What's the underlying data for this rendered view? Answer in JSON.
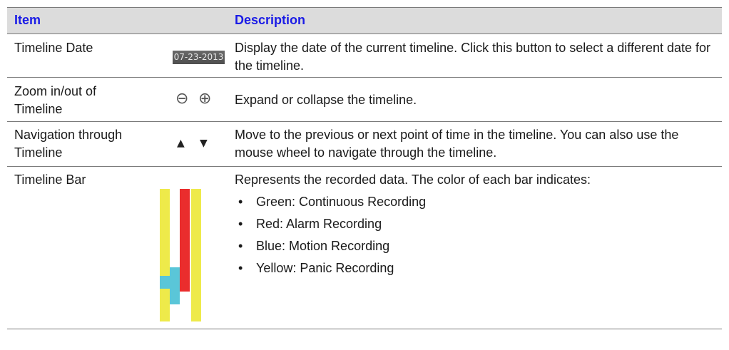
{
  "header": {
    "item": "Item",
    "description": "Description"
  },
  "rows": [
    {
      "item": "Timeline Date",
      "description": "Display the date of the current timeline. Click this button to select a different date for the timeline.",
      "icon": "date-button",
      "date_label": "07-23-2013"
    },
    {
      "item": "Zoom in/out of Timeline",
      "description": "Expand or collapse the timeline.",
      "icon": "zoom-icons",
      "zoom_out_glyph": "⊖",
      "zoom_in_glyph": "⊕"
    },
    {
      "item": "Navigation through Timeline",
      "description": "Move to the previous or next point of time in the timeline. You can also use the mouse wheel to navigate through the timeline.",
      "icon": "arrow-icons",
      "up_glyph": "▲",
      "down_glyph": "▼"
    },
    {
      "item": "Timeline Bar",
      "description": "Represents the recorded data. The color of each bar indicates:",
      "icon": "timeline-bar-icon",
      "bullets": [
        "Green: Continuous Recording",
        "Red: Alarm Recording",
        "Blue: Motion Recording",
        "Yellow: Panic Recording"
      ]
    }
  ],
  "colors": {
    "header_text": "#1a1be6",
    "header_bg": "#dcdcdc",
    "yellow": "#eeea4a",
    "red": "#ea2d2d",
    "blue": "#5ac6d8"
  }
}
